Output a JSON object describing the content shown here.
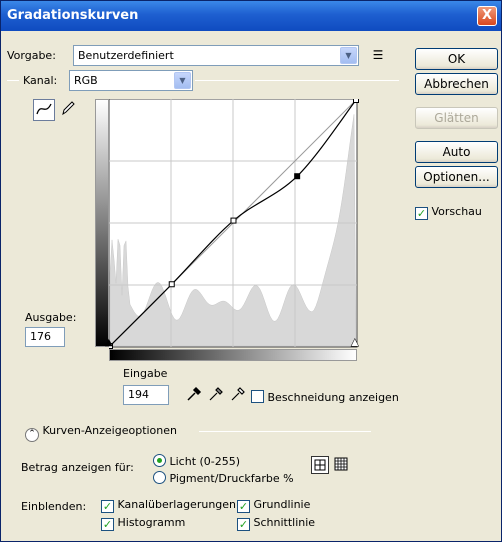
{
  "window": {
    "title": "Gradationskurven",
    "close_label": "X"
  },
  "preset": {
    "label": "Vorgabe:",
    "value": "Benutzerdefiniert"
  },
  "channel": {
    "label": "Kanal:",
    "value": "RGB"
  },
  "buttons": {
    "ok": "OK",
    "cancel": "Abbrechen",
    "smooth": "Glätten",
    "auto": "Auto",
    "options": "Optionen..."
  },
  "preview": {
    "label": "Vorschau",
    "checked": true
  },
  "output": {
    "label": "Ausgabe:",
    "value": "176"
  },
  "input": {
    "label": "Eingabe",
    "value": "194"
  },
  "clipping": {
    "label": "Beschneidung anzeigen",
    "checked": false
  },
  "curve_options": {
    "label": "Kurven-Anzeigeoptionen"
  },
  "amount": {
    "label": "Betrag anzeigen für:",
    "options": [
      {
        "label": "Licht (0-255)",
        "selected": true
      },
      {
        "label": "Pigment/Druckfarbe %",
        "selected": false
      }
    ]
  },
  "show": {
    "label": "Einblenden:",
    "items": [
      {
        "label": "Kanalüberlagerungen",
        "checked": true
      },
      {
        "label": "Grundlinie",
        "checked": true
      },
      {
        "label": "Histogramm",
        "checked": true
      },
      {
        "label": "Schnittlinie",
        "checked": true
      }
    ]
  },
  "curve": {
    "points": [
      [
        0,
        0
      ],
      [
        64,
        64
      ],
      [
        128,
        130
      ],
      [
        194,
        176
      ],
      [
        255,
        255
      ]
    ],
    "selected_point": [
      194,
      176
    ]
  },
  "icons": {
    "curve_tool": "curve-point-icon",
    "pencil_tool": "pencil-icon",
    "eyedropper_black": "eyedropper-black-icon",
    "eyedropper_gray": "eyedropper-gray-icon",
    "eyedropper_white": "eyedropper-white-icon",
    "grid_simple": "grid-4x4-icon",
    "grid_detailed": "grid-10x10-icon",
    "collapse": "chevron-up-icon",
    "menu": "preset-menu-icon"
  }
}
